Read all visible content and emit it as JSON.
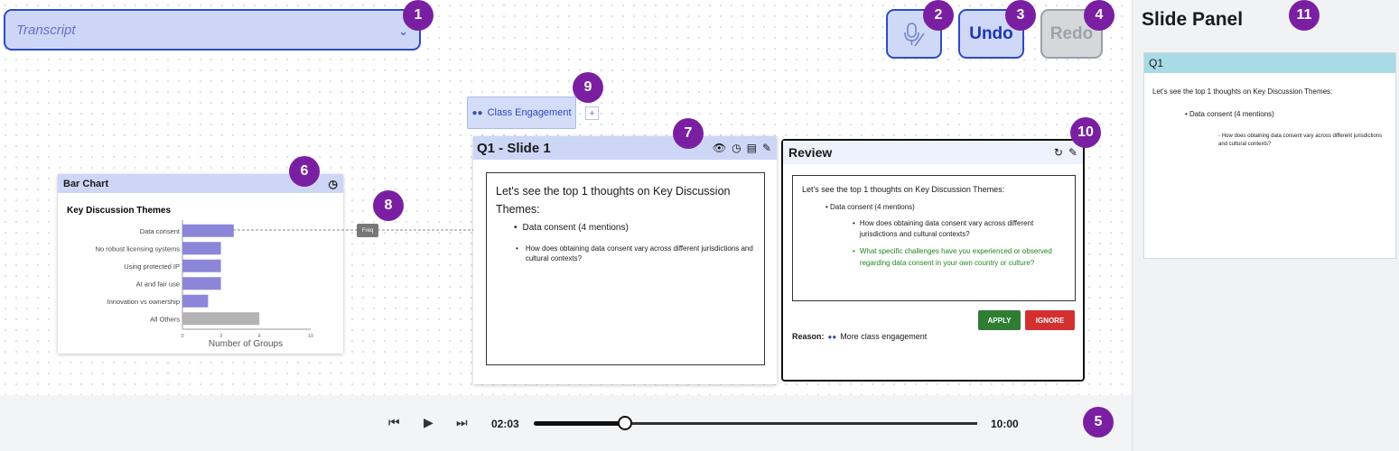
{
  "transcript": {
    "placeholder": "Transcript"
  },
  "toolbar": {
    "undo_label": "Undo",
    "redo_label": "Redo"
  },
  "badges": [
    "1",
    "2",
    "3",
    "4",
    "5",
    "6",
    "7",
    "8",
    "9",
    "10",
    "11"
  ],
  "tabs": {
    "class_engagement": "Class Engagement",
    "add": "+"
  },
  "bar_chart_card": {
    "header": "Bar Chart"
  },
  "chart_data": {
    "type": "bar",
    "orientation": "horizontal",
    "title": "Key Discussion Themes",
    "xlabel": "Number of Groups",
    "categories": [
      "Data consent",
      "No robust licensing systems",
      "Using protected IP",
      "AI and fair use",
      "Innovation vs ownership",
      "All Others"
    ],
    "values": [
      4,
      3,
      3,
      3,
      2,
      6
    ],
    "colors": [
      "#8c86d9",
      "#8c86d9",
      "#8c86d9",
      "#8c86d9",
      "#8c86d9",
      "#b3b3b3"
    ],
    "xlim": [
      0,
      10
    ],
    "xticks": [
      "0",
      "3",
      "6",
      "10"
    ]
  },
  "connector": {
    "tag": "Freq"
  },
  "slide": {
    "header": "Q1 - Slide 1",
    "intro": "Let's see the top 1 thoughts on Key Discussion Themes:",
    "bullet1": "Data consent (4 mentions)",
    "bullet2": "How does obtaining data consent vary across different jurisdictions and cultural contexts?"
  },
  "review": {
    "header": "Review",
    "intro": "Let's see the top 1 thoughts on Key Discussion Themes:",
    "bullet1": "• Data consent (4 mentions)",
    "bullet2": "How does obtaining data consent vary across different jurisdictions and cultural contexts?",
    "bullet3": "What specific challenges have you experienced or observed regarding data consent in your own country or culture?",
    "apply": "APPLY",
    "ignore": "IGNORE",
    "reason_label": "Reason:",
    "reason_text": "More class engagement"
  },
  "slide_panel": {
    "title": "Slide Panel",
    "card_header": "Q1",
    "intro": "Let's see the top 1 thoughts on Key Discussion Themes:",
    "bullet1": "• Data consent (4 mentions)",
    "bullet2": "◦ How does obtaining data consent vary across different jurisdictions and cultural contexts?"
  },
  "player": {
    "current": "02:03",
    "total": "10:00",
    "progress": 0.205
  }
}
